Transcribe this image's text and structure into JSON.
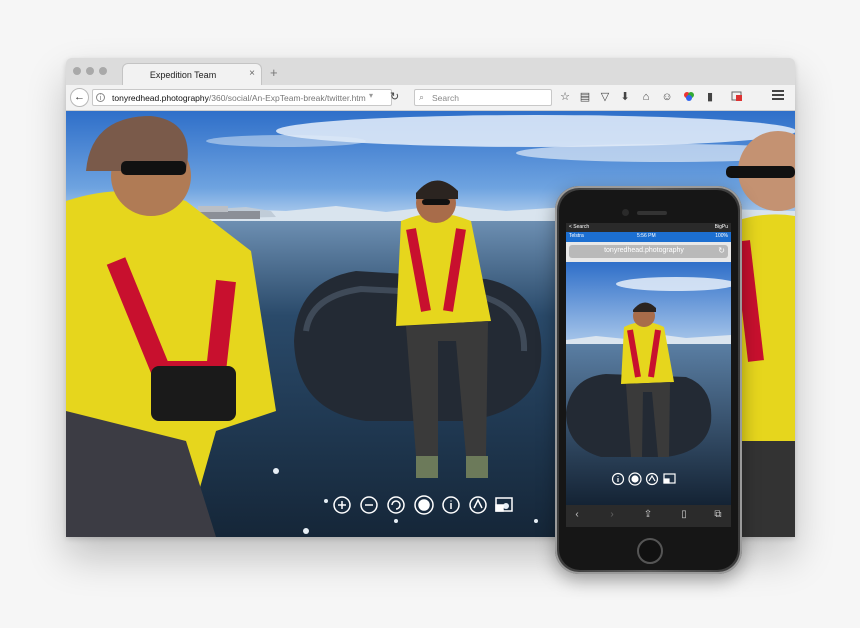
{
  "browser": {
    "tab_title": "Expedition Team",
    "tab_close": "×",
    "new_tab": "+",
    "url_host": "tonyredhead.photography",
    "url_path": "/360/social/An-ExpTeam-break/twitter.htm",
    "search_placeholder": "Search",
    "toolbar_icons": [
      "bookmark-star-icon",
      "clipboard-icon",
      "pocket-icon",
      "download-icon",
      "home-icon",
      "chat-icon",
      "color-extension-icon",
      "battery-icon",
      "extension-badge-icon",
      "menu-icon"
    ]
  },
  "viewer_controls": [
    "zoom-in-icon",
    "zoom-out-icon",
    "autorotate-icon",
    "gyro-toggle-icon",
    "info-icon",
    "drag-mode-icon",
    "fullscreen-icon"
  ],
  "phone": {
    "carrier": "Telstra",
    "time": "5:56 PM",
    "battery": "100%",
    "back_label": "< Search",
    "network": "BigPu",
    "url": "tonyredhead.photography",
    "controls": [
      "info-icon",
      "gyro-toggle-icon",
      "drag-mode-icon",
      "fullscreen-icon"
    ],
    "toolbar": [
      "back-arrow-icon",
      "forward-arrow-icon",
      "share-icon",
      "bookmarks-icon",
      "tabs-icon"
    ]
  },
  "colors": {
    "jacket": "#e6d61d",
    "harness": "#c8102e",
    "sky": "#3c7fd6",
    "water": "#1d3550"
  }
}
